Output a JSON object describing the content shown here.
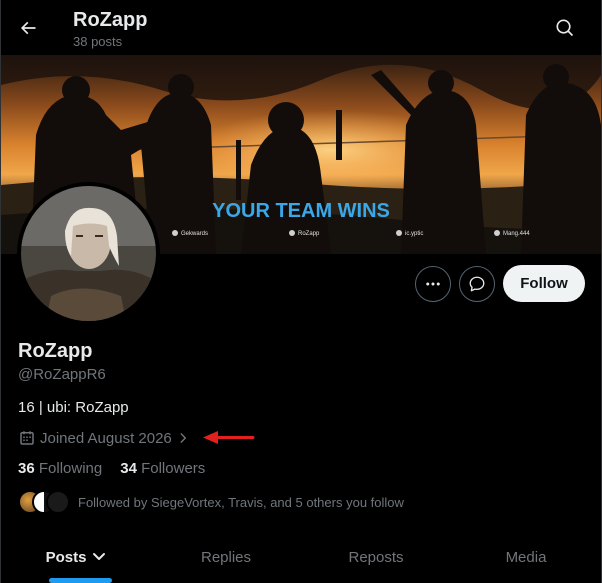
{
  "header": {
    "title": "RoZapp",
    "subtitle": "38 posts",
    "back_icon": "arrow-left-icon",
    "search_icon": "search-icon"
  },
  "banner": {
    "headline": "YOUR TEAM WINS",
    "players": [
      "Gekwards",
      "RoZapp",
      "ic.yptic",
      "Mang.444"
    ],
    "headline_color": "#3aa8e8"
  },
  "actions": {
    "more_icon": "more-horizontal-icon",
    "message_icon": "message-icon",
    "follow_label": "Follow"
  },
  "profile": {
    "name": "RoZapp",
    "handle": "@RoZappR6",
    "bio": "16 | ubi: RoZapp",
    "joined": "Joined August 2026",
    "calendar_icon": "calendar-icon",
    "joined_chevron_icon": "chevron-right-icon"
  },
  "annotation": {
    "arrow_color": "#e32020",
    "arrow_icon": "arrow-left-icon"
  },
  "stats": {
    "following_count": "36",
    "following_label": "Following",
    "followers_count": "34",
    "followers_label": "Followers"
  },
  "followed_by": {
    "text": "Followed by SiegeVortex, Travis, and 5 others you follow"
  },
  "tabs": [
    {
      "label": "Posts",
      "active": true
    },
    {
      "label": "Replies",
      "active": false
    },
    {
      "label": "Reposts",
      "active": false
    },
    {
      "label": "Media",
      "active": false
    }
  ],
  "colors": {
    "background": "#000000",
    "text_primary": "#e7e9ea",
    "text_secondary": "#71767b",
    "accent": "#1d9bf0",
    "follow_button_bg": "#eff3f4"
  }
}
